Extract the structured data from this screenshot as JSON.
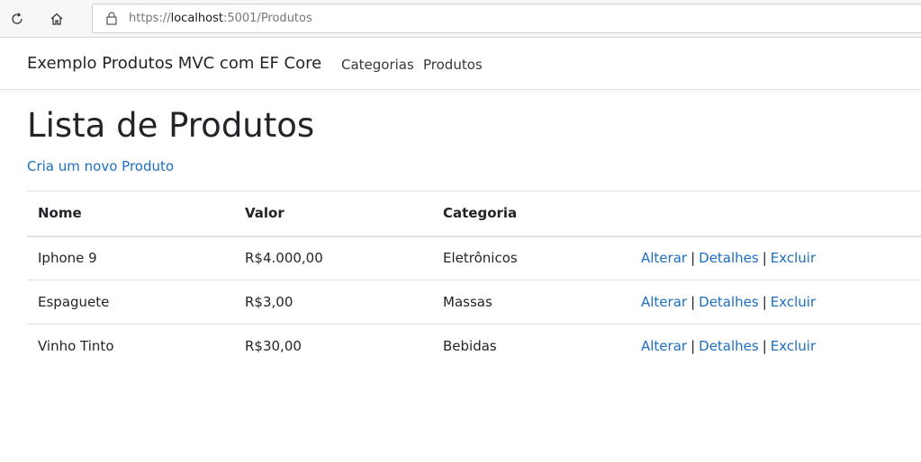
{
  "browser": {
    "url_scheme": "https://",
    "url_host": "localhost",
    "url_rest": ":5001/Produtos",
    "icons": {
      "reload": "reload-icon",
      "home": "home-icon",
      "lock": "lock-icon"
    }
  },
  "navbar": {
    "brand": "Exemplo Produtos MVC com EF Core",
    "links": [
      {
        "label": "Categorias"
      },
      {
        "label": "Produtos"
      }
    ]
  },
  "main": {
    "title": "Lista de Produtos",
    "create_link": "Cria um novo Produto",
    "table": {
      "headers": [
        "Nome",
        "Valor",
        "Categoria",
        ""
      ],
      "rows": [
        {
          "nome": "Iphone 9",
          "valor": "R$4.000,00",
          "categoria": "Eletrônicos"
        },
        {
          "nome": "Espaguete",
          "valor": "R$3,00",
          "categoria": "Massas"
        },
        {
          "nome": "Vinho Tinto",
          "valor": "R$30,00",
          "categoria": "Bebidas"
        }
      ],
      "actions": {
        "edit": "Alterar",
        "details": "Detalhes",
        "delete": "Excluir",
        "separator": "|"
      }
    }
  },
  "colors": {
    "link": "#1b6ec2",
    "text": "#212529",
    "border": "#dee2e6"
  }
}
